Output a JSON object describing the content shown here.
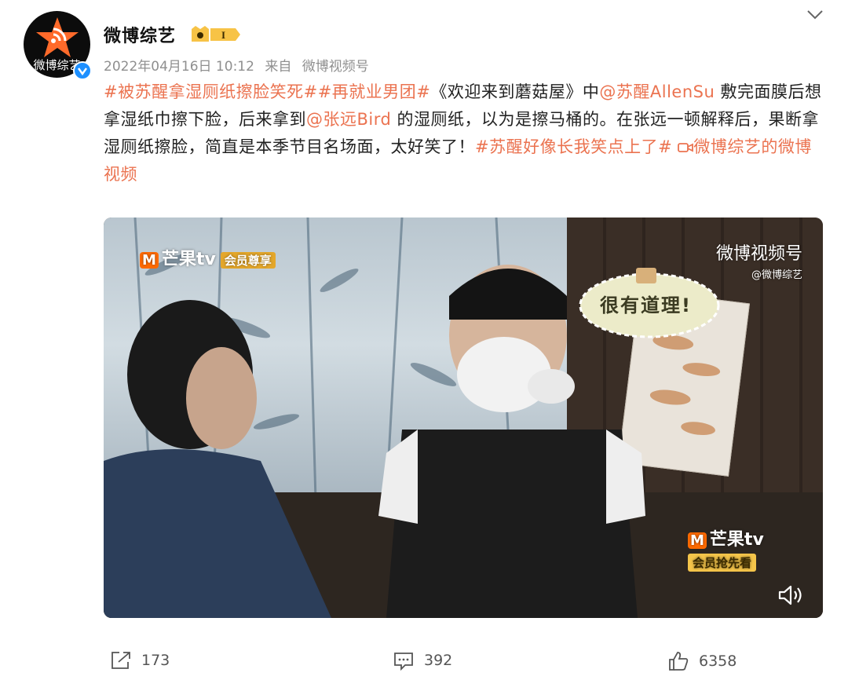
{
  "header": {
    "avatar_text": "微博综艺",
    "username": "微博综艺",
    "badge_text": "I",
    "date": "2022年04月16日 10:12",
    "source_prefix": "来自",
    "source": "微博视频号"
  },
  "post": {
    "tag1": "#被苏醒拿湿厕纸擦脸笑死##再就业男团#",
    "text1": "《欢迎来到蘑菇屋》中",
    "mention1": "@苏醒AllenSu",
    "text2": " 敷完面膜后想拿湿纸巾擦下脸，后来拿到",
    "mention2": "@张远Bird",
    "text3": " 的湿厕纸，以为是擦马桶的。在张远一顿解释后，果断拿湿厕纸擦脸，简直是本季节目名场面，太好笑了！",
    "tag2": "#苏醒好像长我笑点上了#",
    "video_link": "微博综艺的微博视频"
  },
  "video": {
    "logo_tl": "芒果tv",
    "logo_tl_vip": "会员尊享",
    "watermark_title": "微博视频号",
    "watermark_sub": "@微博综艺",
    "bubble_text": "很有道理!",
    "logo_br": "芒果tv",
    "logo_br_sub": "会员抢先看"
  },
  "footer": {
    "share_count": "173",
    "comment_count": "392",
    "like_count": "6358"
  },
  "colors": {
    "accent": "#eb7350",
    "verified": "#1e90ff",
    "meta": "#8f8f8f"
  },
  "icons": [
    "chevron-down-icon",
    "verified-icon",
    "vip-badge-icon",
    "share-icon",
    "comment-icon",
    "like-icon",
    "volume-icon",
    "video-camera-icon"
  ]
}
